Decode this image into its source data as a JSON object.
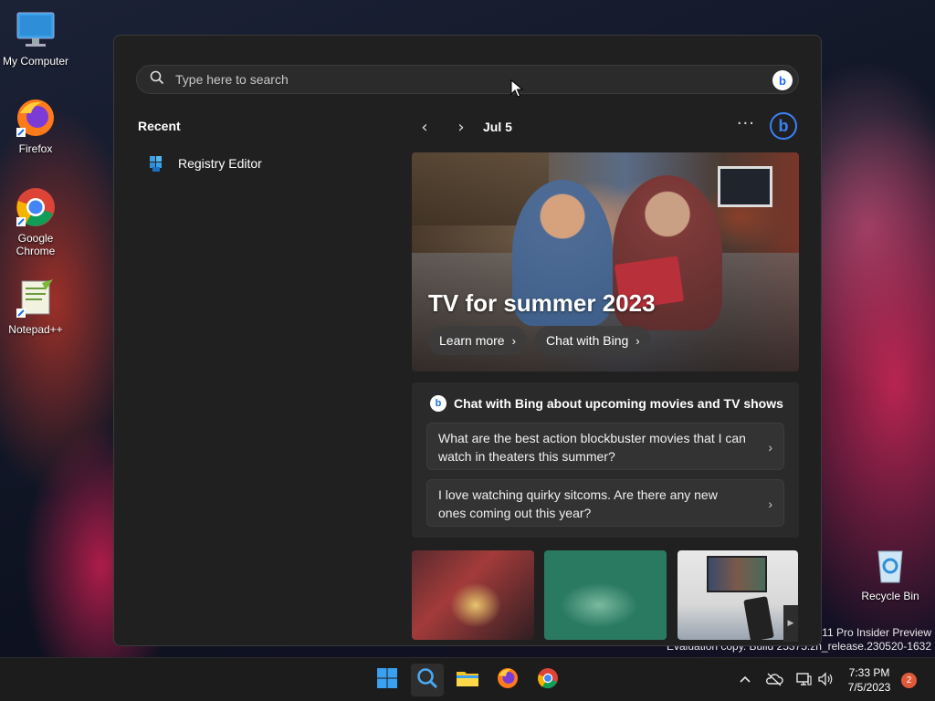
{
  "desktop": {
    "icons": [
      {
        "label": "My Computer",
        "icon": "monitor-icon"
      },
      {
        "label": "Firefox",
        "icon": "firefox-icon"
      },
      {
        "label": "Google Chrome",
        "icon": "chrome-icon"
      },
      {
        "label": "Notepad++",
        "icon": "notepadpp-icon"
      },
      {
        "label": "Recycle Bin",
        "icon": "recycle-bin-icon"
      }
    ],
    "watermark_line1": "s 11 Pro Insider Preview",
    "watermark_line2": "Evaluation copy. Build 25375.zn_release.230520-1632"
  },
  "search": {
    "placeholder": "Type here to search",
    "recent_title": "Recent",
    "recent_items": [
      {
        "label": "Registry Editor",
        "icon": "registry-editor-icon"
      }
    ],
    "nav": {
      "date": "Jul 5",
      "more": "···"
    },
    "hero": {
      "title": "TV for summer 2023",
      "learn_more": "Learn more",
      "chat_with_bing": "Chat with Bing"
    },
    "chat_card": {
      "heading": "Chat with Bing about upcoming movies and TV shows",
      "questions": [
        "What are the best action blockbuster movies that I can watch in theaters this summer?",
        "I love watching quirky sitcoms. Are there any new ones coming out this year?"
      ]
    }
  },
  "taskbar": {
    "apps": [
      "start-icon",
      "search-icon",
      "file-explorer-icon",
      "firefox-icon",
      "chrome-icon"
    ],
    "clock_time": "7:33 PM",
    "clock_date": "7/5/2023",
    "notification_count": "2"
  },
  "colors": {
    "panel_bg": "#202020",
    "accent_blue": "#3b82f6",
    "taskbar_bg": "#1c1c1c",
    "notification_badge": "#e05a3a"
  }
}
